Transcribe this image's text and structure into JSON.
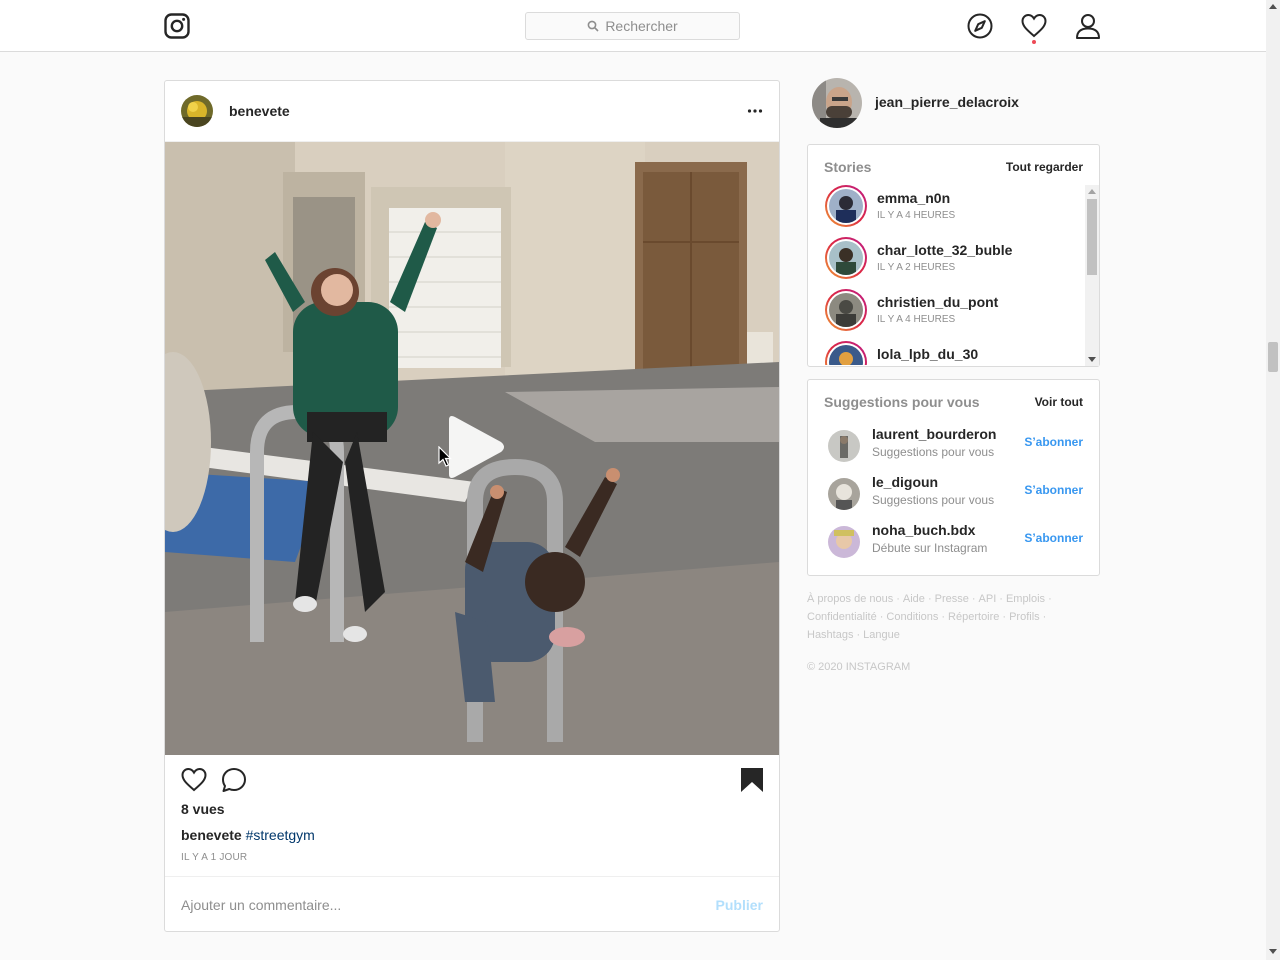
{
  "nav": {
    "search_placeholder": "Rechercher",
    "icons": [
      "instagram-logo-icon",
      "compass-icon",
      "heart-icon",
      "profile-icon"
    ],
    "notification_dot_color": "#ed4956"
  },
  "post": {
    "username": "benevete",
    "views": "8 vues",
    "caption_user": "benevete",
    "caption_tag": "#streetgym",
    "time_ago": "IL Y A 1 JOUR",
    "comment_placeholder": "Ajouter un commentaire...",
    "publish_label": "Publier"
  },
  "sidebar": {
    "current_user": "jean_pierre_delacroix",
    "stories": {
      "title": "Stories",
      "see_all": "Tout regarder",
      "items": [
        {
          "name": "emma_n0n",
          "time": "IL Y A 4 HEURES"
        },
        {
          "name": "char_lotte_32_buble",
          "time": "IL Y A 2 HEURES"
        },
        {
          "name": "christien_du_pont",
          "time": "IL Y A 4 HEURES"
        },
        {
          "name": "lola_lpb_du_30",
          "time": ""
        }
      ]
    },
    "suggestions": {
      "title": "Suggestions pour vous",
      "see_all": "Voir tout",
      "follow_label": "S’abonner",
      "items": [
        {
          "name": "laurent_bourderon",
          "sub": "Suggestions pour vous"
        },
        {
          "name": "le_digoun",
          "sub": "Suggestions pour vous"
        },
        {
          "name": "noha_buch.bdx",
          "sub": "Débute sur Instagram"
        }
      ]
    },
    "footer": {
      "links": [
        "À propos de nous",
        "Aide",
        "Presse",
        "API",
        "Emplois",
        "Confidentialité",
        "Conditions",
        "Répertoire",
        "Profils",
        "Hashtags",
        "Langue"
      ],
      "copyright": "© 2020 INSTAGRAM"
    }
  },
  "colors": {
    "link_blue": "#3897f0",
    "hashtag": "#00376b",
    "muted": "#8e8e8e",
    "border": "#dbdbdb"
  }
}
